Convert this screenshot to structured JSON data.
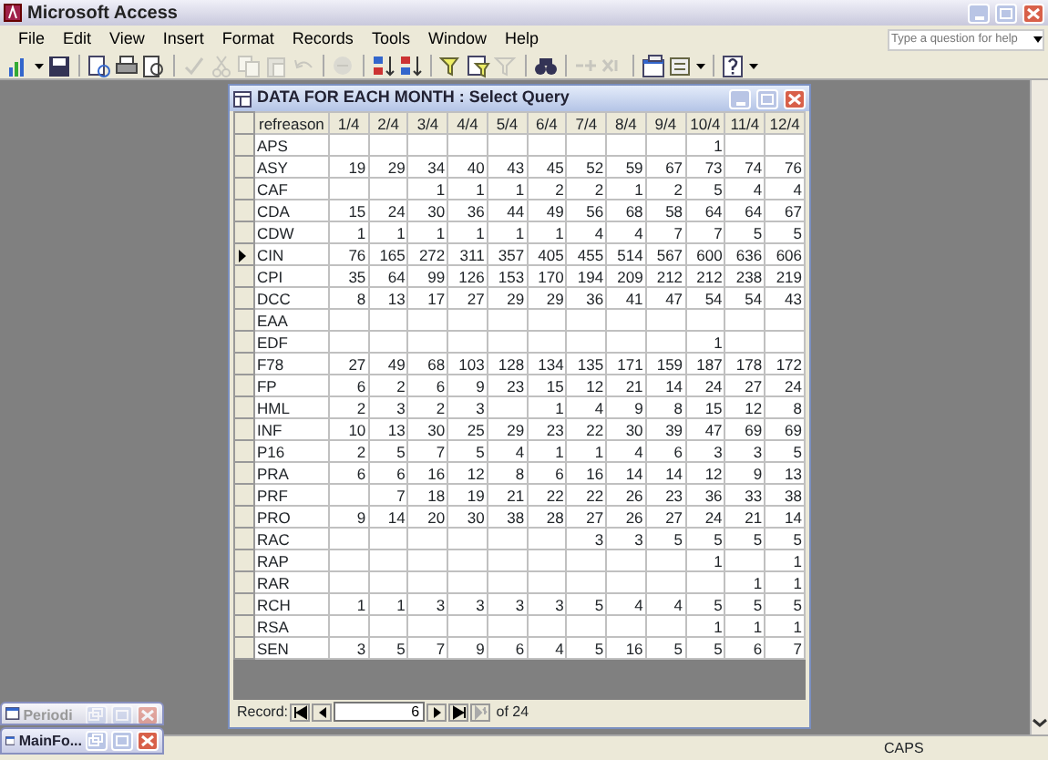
{
  "window": {
    "title": "Microsoft Access"
  },
  "menu": [
    "File",
    "Edit",
    "View",
    "Insert",
    "Format",
    "Records",
    "Tools",
    "Window",
    "Help"
  ],
  "help_box": {
    "placeholder": "Type a question for help"
  },
  "toolbar": [
    {
      "kind": "view",
      "disabled": false
    },
    {
      "kind": "save",
      "disabled": false
    },
    {
      "kind": "search",
      "disabled": false
    },
    {
      "kind": "print",
      "disabled": false
    },
    {
      "kind": "preview",
      "disabled": false
    },
    {
      "kind": "spelling",
      "disabled": true
    },
    {
      "kind": "cut",
      "disabled": true
    },
    {
      "kind": "copy",
      "disabled": true
    },
    {
      "kind": "paste",
      "disabled": true
    },
    {
      "kind": "undo",
      "disabled": true
    },
    {
      "kind": "link",
      "disabled": true
    },
    {
      "kind": "sortasc",
      "disabled": false
    },
    {
      "kind": "sortdesc",
      "disabled": false
    },
    {
      "kind": "filter",
      "disabled": false
    },
    {
      "kind": "form",
      "disabled": false
    },
    {
      "kind": "funnel",
      "disabled": true
    },
    {
      "kind": "find",
      "disabled": false
    },
    {
      "kind": "newrec",
      "disabled": true
    },
    {
      "kind": "delrec",
      "disabled": true
    },
    {
      "kind": "dbwin",
      "disabled": false
    },
    {
      "kind": "newobj",
      "disabled": false
    },
    {
      "kind": "help",
      "disabled": false
    }
  ],
  "query_window": {
    "title": "DATA FOR EACH MONTH : Select Query",
    "columns": [
      "refreason",
      "1/4",
      "2/4",
      "3/4",
      "4/4",
      "5/4",
      "6/4",
      "7/4",
      "8/4",
      "9/4",
      "10/4",
      "11/4",
      "12/4"
    ],
    "rows": [
      {
        "reason": "APS",
        "selected": false,
        "values": {
          "col_10": "1"
        }
      },
      {
        "reason": "ASY",
        "selected": false,
        "values": [
          "19",
          "29",
          "34",
          "40",
          "43",
          "45",
          "52",
          "59",
          "67",
          "73",
          "74",
          "76"
        ]
      },
      {
        "reason": "CAF",
        "selected": false,
        "values": {
          "col_3": "1",
          "col_4": "1",
          "col_5": "1",
          "col_6": "2",
          "col_7": "2",
          "col_8": "1",
          "col_9": "2",
          "col_10": "5",
          "col_11": "4",
          "col_12": "4"
        }
      },
      {
        "reason": "CDA",
        "selected": false,
        "values": [
          "15",
          "24",
          "30",
          "36",
          "44",
          "49",
          "56",
          "68",
          "58",
          "64",
          "64",
          "67"
        ]
      },
      {
        "reason": "CDW",
        "selected": false,
        "values": [
          "1",
          "1",
          "1",
          "1",
          "1",
          "1",
          "4",
          "4",
          "7",
          "7",
          "5",
          "5"
        ]
      },
      {
        "reason": "CIN",
        "selected": true,
        "values": [
          "76",
          "165",
          "272",
          "311",
          "357",
          "405",
          "455",
          "514",
          "567",
          "600",
          "636",
          "606"
        ]
      },
      {
        "reason": "CPI",
        "selected": false,
        "values": [
          "35",
          "64",
          "99",
          "126",
          "153",
          "170",
          "194",
          "209",
          "212",
          "212",
          "238",
          "219"
        ]
      },
      {
        "reason": "DCC",
        "selected": false,
        "values": [
          "8",
          "13",
          "17",
          "27",
          "29",
          "29",
          "36",
          "41",
          "47",
          "54",
          "54",
          "43"
        ]
      },
      {
        "reason": "EAA",
        "selected": false
      },
      {
        "reason": "EDF",
        "selected": false,
        "values": {
          "col_10": "1"
        }
      },
      {
        "reason": "F78",
        "selected": false,
        "values": [
          "27",
          "49",
          "68",
          "103",
          "128",
          "134",
          "135",
          "171",
          "159",
          "187",
          "178",
          "172"
        ]
      },
      {
        "reason": "FP",
        "selected": false,
        "values": [
          "6",
          "2",
          "6",
          "9",
          "23",
          "15",
          "12",
          "21",
          "14",
          "24",
          "27",
          "24"
        ]
      },
      {
        "reason": "HML",
        "selected": false,
        "values": {
          "col_1": "2",
          "col_2": "3",
          "col_3": "2",
          "col_4": "3",
          "col_6": "1",
          "col_7": "4",
          "col_8": "9",
          "col_9": "8",
          "col_10": "15",
          "col_11": "12",
          "col_12": "8"
        }
      },
      {
        "reason": "INF",
        "selected": false,
        "values": [
          "10",
          "13",
          "30",
          "25",
          "29",
          "23",
          "22",
          "30",
          "39",
          "47",
          "69",
          "69"
        ]
      },
      {
        "reason": "P16",
        "selected": false,
        "values": [
          "2",
          "5",
          "7",
          "5",
          "4",
          "1",
          "1",
          "4",
          "6",
          "3",
          "3",
          "5"
        ]
      },
      {
        "reason": "PRA",
        "selected": false,
        "values": [
          "6",
          "6",
          "16",
          "12",
          "8",
          "6",
          "16",
          "14",
          "14",
          "12",
          "9",
          "13"
        ]
      },
      {
        "reason": "PRF",
        "selected": false,
        "values": {
          "col_2": "7",
          "col_3": "18",
          "col_4": "19",
          "col_5": "21",
          "col_6": "22",
          "col_7": "22",
          "col_8": "26",
          "col_9": "23",
          "col_10": "36",
          "col_11": "33",
          "col_12": "38"
        }
      },
      {
        "reason": "PRO",
        "selected": false,
        "values": [
          "9",
          "14",
          "20",
          "30",
          "38",
          "28",
          "27",
          "26",
          "27",
          "24",
          "21",
          "14"
        ]
      },
      {
        "reason": "RAC",
        "selected": false,
        "values": {
          "col_7": "3",
          "col_8": "3",
          "col_9": "5",
          "col_10": "5",
          "col_11": "5",
          "col_12": "5"
        }
      },
      {
        "reason": "RAP",
        "selected": false,
        "values": {
          "col_10": "1",
          "col_12": "1"
        }
      },
      {
        "reason": "RAR",
        "selected": false,
        "values": {
          "col_11": "1",
          "col_12": "1"
        }
      },
      {
        "reason": "RCH",
        "selected": false,
        "values": [
          "1",
          "1",
          "3",
          "3",
          "3",
          "3",
          "5",
          "4",
          "4",
          "5",
          "5",
          "5"
        ]
      },
      {
        "reason": "RSA",
        "selected": false,
        "values": {
          "col_10": "1",
          "col_11": "1",
          "col_12": "1"
        }
      },
      {
        "reason": "SEN",
        "selected": false,
        "values": [
          "3",
          "5",
          "7",
          "9",
          "6",
          "4",
          "5",
          "16",
          "5",
          "5",
          "6",
          "7"
        ]
      }
    ],
    "navigator": {
      "label": "Record:",
      "value": "6",
      "total": "of 24"
    }
  },
  "minimized_windows": [
    {
      "title": "Periodi",
      "active": false
    },
    {
      "title": "MainFo...",
      "active": true
    }
  ],
  "status_bar": {
    "caps": "CAPS"
  }
}
